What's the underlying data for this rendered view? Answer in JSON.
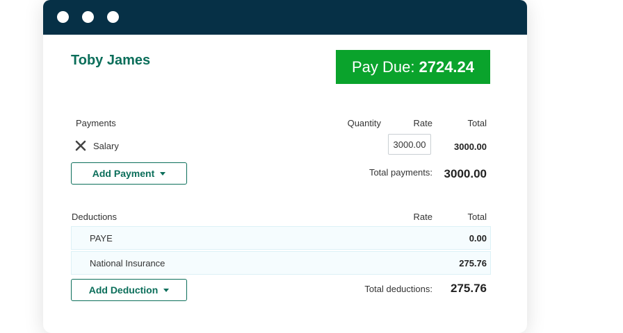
{
  "employee": {
    "name": "Toby James"
  },
  "pay_due": {
    "label": "Pay Due:",
    "amount": "2724.24"
  },
  "payments": {
    "heading": "Payments",
    "col_quantity": "Quantity",
    "col_rate": "Rate",
    "col_total": "Total",
    "items": [
      {
        "name": "Salary",
        "quantity": "",
        "rate": "3000.00",
        "total": "3000.00"
      }
    ],
    "add_label": "Add Payment",
    "total_label": "Total payments:",
    "total_value": "3000.00"
  },
  "deductions": {
    "heading": "Deductions",
    "col_rate": "Rate",
    "col_total": "Total",
    "items": [
      {
        "name": "PAYE",
        "total": "0.00"
      },
      {
        "name": "National Insurance",
        "total": "275.76"
      }
    ],
    "add_label": "Add Deduction",
    "total_label": "Total deductions:",
    "total_value": "275.76"
  },
  "colors": {
    "titlebar": "#063046",
    "pay_due_bg": "#0aa32c",
    "accent": "#0b6e5a",
    "row_bg": "#f5fcfe"
  },
  "icons": {
    "remove": "close-x-icon",
    "dropdown": "caret-down-icon"
  }
}
